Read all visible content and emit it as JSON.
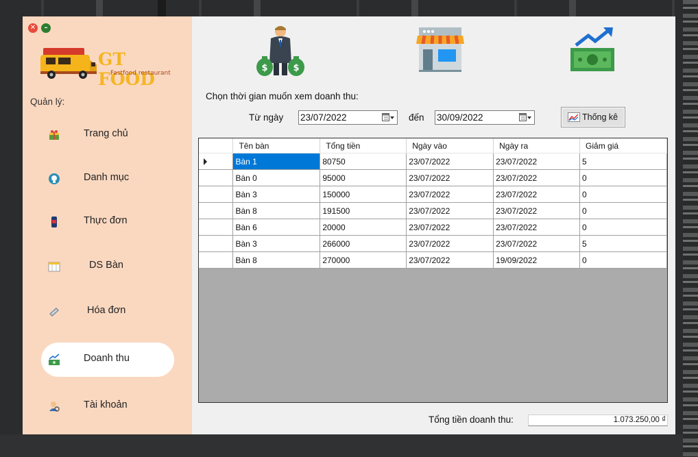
{
  "app": {
    "brand_name": "GT FOOD",
    "brand_tagline": "Fastfood restaurant",
    "window_buttons": [
      "close",
      "minimize"
    ]
  },
  "sidebar": {
    "section_label": "Quản lý:",
    "items": [
      {
        "label": "Trang chủ",
        "icon": "gift-icon",
        "active": false
      },
      {
        "label": "Danh mục",
        "icon": "catalog-icon",
        "active": false
      },
      {
        "label": "Thực đơn",
        "icon": "drink-icon",
        "active": false
      },
      {
        "label": "DS Bàn",
        "icon": "table-icon",
        "active": false
      },
      {
        "label": "Hóa đơn",
        "icon": "bill-icon",
        "active": false
      },
      {
        "label": "Doanh thu",
        "icon": "revenue-icon",
        "active": true
      },
      {
        "label": "Tài khoản",
        "icon": "account-icon",
        "active": false
      }
    ]
  },
  "header_icons": [
    "businessman-money-icon",
    "storefront-icon",
    "money-growth-icon"
  ],
  "filter": {
    "prompt": "Chọn thời gian muốn xem doanh thu:",
    "from_label": "Từ ngày",
    "from_value": "23/07/2022",
    "to_label": "đến",
    "to_value": "30/09/2022",
    "button_label": "Thống kê"
  },
  "table": {
    "columns": [
      "Tên bàn",
      "Tổng tiền",
      "Ngày vào",
      "Ngày ra",
      "Giảm giá"
    ],
    "rows": [
      [
        "Bàn 1",
        "80750",
        "23/07/2022",
        "23/07/2022",
        "5"
      ],
      [
        "Bàn 0",
        "95000",
        "23/07/2022",
        "23/07/2022",
        "0"
      ],
      [
        "Bàn 3",
        "150000",
        "23/07/2022",
        "23/07/2022",
        "0"
      ],
      [
        "Bàn 8",
        "191500",
        "23/07/2022",
        "23/07/2022",
        "0"
      ],
      [
        "Bàn 6",
        "20000",
        "23/07/2022",
        "23/07/2022",
        "0"
      ],
      [
        "Bàn 3",
        "266000",
        "23/07/2022",
        "23/07/2022",
        "5"
      ],
      [
        "Bàn 8",
        "270000",
        "23/07/2022",
        "19/09/2022",
        "0"
      ]
    ],
    "selected_row": 0
  },
  "summary": {
    "label": "Tổng tiền doanh thu:",
    "value": "1.073.250,00 ₫"
  },
  "colors": {
    "sidebar_bg": "#fad8c0",
    "selected_cell": "#0078d7",
    "brand_yellow": "#f5b521"
  }
}
